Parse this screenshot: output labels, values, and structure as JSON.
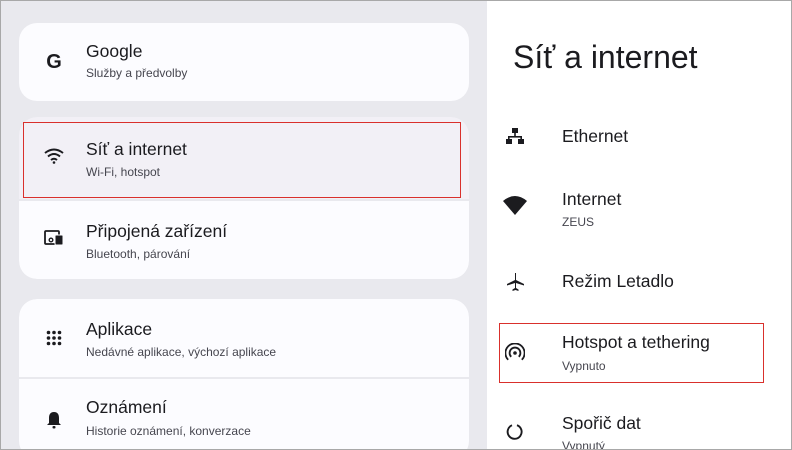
{
  "left_menu": {
    "google": {
      "icon": "google-g-icon",
      "letter": "G",
      "title": "Google",
      "subtitle": "Služby a předvolby"
    },
    "network": {
      "icon": "wifi-icon",
      "title": "Síť a internet",
      "subtitle": "Wi-Fi, hotspot"
    },
    "devices": {
      "icon": "connected-devices-icon",
      "title": "Připojená zařízení",
      "subtitle": "Bluetooth, párování"
    },
    "apps": {
      "icon": "apps-grid-icon",
      "title": "Aplikace",
      "subtitle": "Nedávné aplikace, výchozí aplikace"
    },
    "notifications": {
      "icon": "bell-icon",
      "title": "Oznámení",
      "subtitle": "Historie oznámení, konverzace"
    }
  },
  "right_panel": {
    "title": "Síť a internet",
    "items": [
      {
        "icon": "ethernet-icon",
        "title": "Ethernet",
        "subtitle": ""
      },
      {
        "icon": "wifi-full-icon",
        "title": "Internet",
        "subtitle": "ZEUS"
      },
      {
        "icon": "airplane-icon",
        "title": "Režim Letadlo",
        "subtitle": ""
      },
      {
        "icon": "hotspot-icon",
        "title": "Hotspot a tethering",
        "subtitle": "Vypnuto"
      },
      {
        "icon": "data-saver-icon",
        "title": "Spořič dat",
        "subtitle": "Vypnutý"
      }
    ]
  },
  "colors": {
    "left_background": "#e9e9ee",
    "card_background": "#fcfcff",
    "highlight_border": "#d9302c",
    "text_primary": "#1b1b1f",
    "text_secondary": "#46464f"
  }
}
